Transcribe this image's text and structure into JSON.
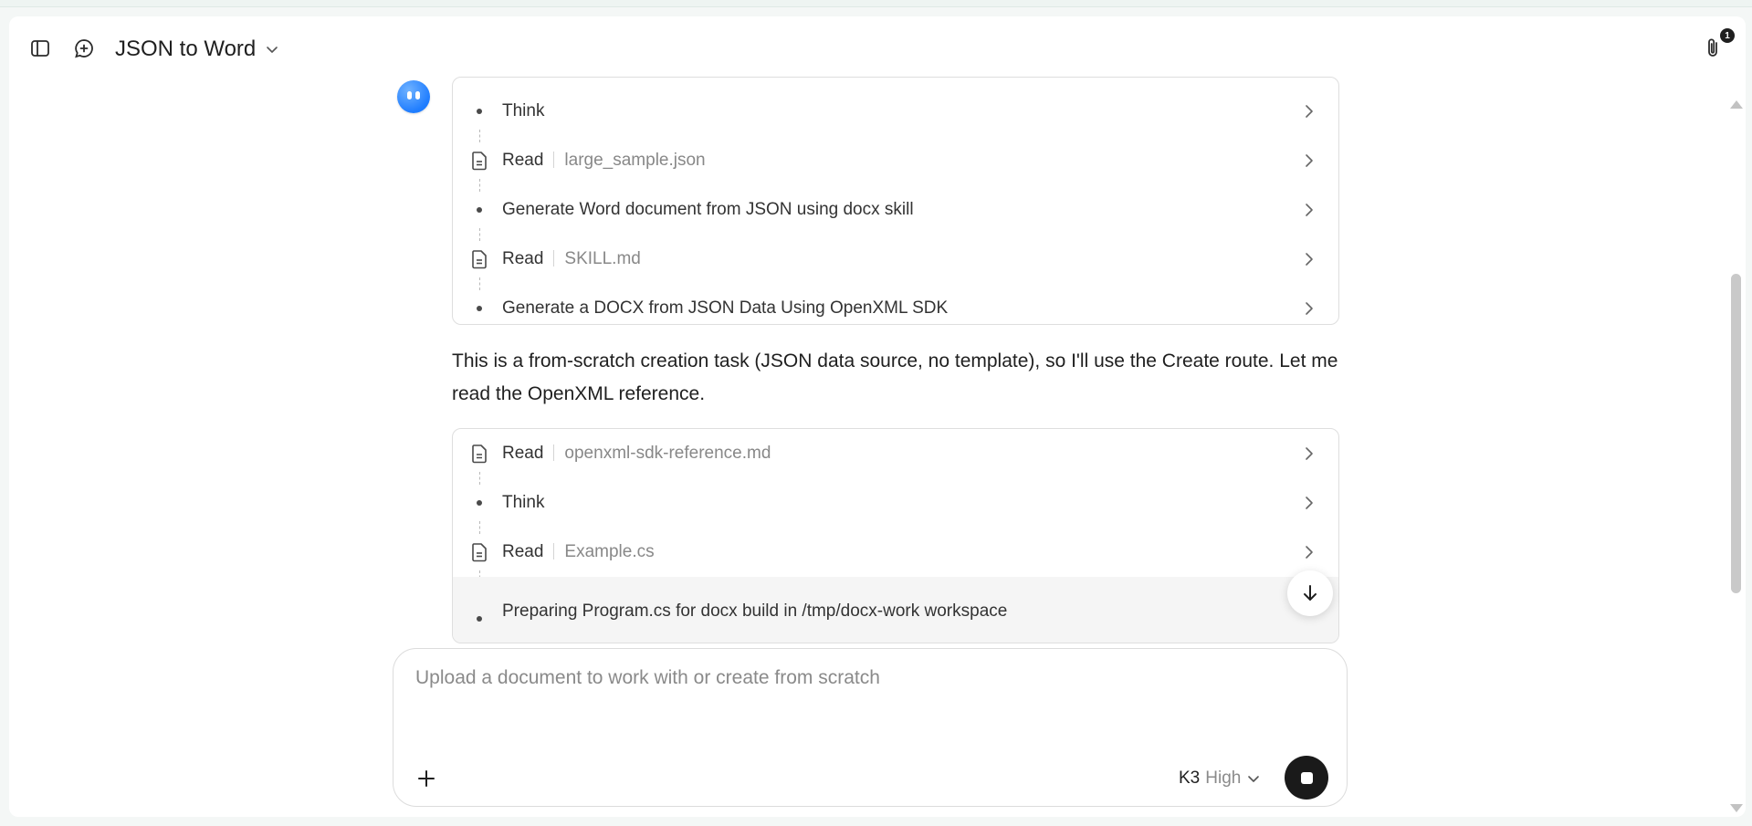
{
  "header": {
    "title": "JSON to Word",
    "attachment_count": "1",
    "icons": [
      "sidebar-toggle-icon",
      "new-chat-icon",
      "chevron-down-icon",
      "paperclip-icon"
    ]
  },
  "steps_group_1": [
    {
      "type": "think",
      "label": "Think"
    },
    {
      "type": "read",
      "label": "Read",
      "file": "large_sample.json"
    },
    {
      "type": "task",
      "label": "Generate Word document from JSON using docx skill"
    },
    {
      "type": "read",
      "label": "Read",
      "file": "SKILL.md"
    },
    {
      "type": "task",
      "label": "Generate a DOCX from JSON Data Using OpenXML SDK"
    }
  ],
  "message": {
    "text": "This is a from-scratch creation task (JSON data source, no template), so I'll use the Create route. Let me read the OpenXML reference."
  },
  "steps_group_2": [
    {
      "type": "read",
      "label": "Read",
      "file": "openxml-sdk-reference.md"
    },
    {
      "type": "think",
      "label": "Think"
    },
    {
      "type": "read",
      "label": "Read",
      "file": "Example.cs"
    },
    {
      "type": "task",
      "label": "Preparing Program.cs for docx build in /tmp/docx-work workspace"
    }
  ],
  "composer": {
    "placeholder": "Upload a document to work with or create from scratch",
    "model_name": "K3",
    "effort": "High"
  },
  "colors": {
    "accent_blue": "#1f7dff",
    "stop_button": "#1a1a1a",
    "border": "#dedede"
  }
}
